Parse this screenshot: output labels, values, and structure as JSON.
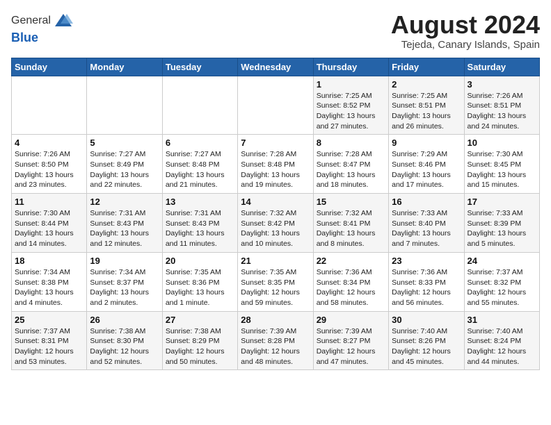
{
  "header": {
    "logo_line1": "General",
    "logo_line2": "Blue",
    "calendar_title": "August 2024",
    "calendar_subtitle": "Tejeda, Canary Islands, Spain"
  },
  "weekdays": [
    "Sunday",
    "Monday",
    "Tuesday",
    "Wednesday",
    "Thursday",
    "Friday",
    "Saturday"
  ],
  "weeks": [
    [
      {
        "day": "",
        "info": ""
      },
      {
        "day": "",
        "info": ""
      },
      {
        "day": "",
        "info": ""
      },
      {
        "day": "",
        "info": ""
      },
      {
        "day": "1",
        "info": "Sunrise: 7:25 AM\nSunset: 8:52 PM\nDaylight: 13 hours\nand 27 minutes."
      },
      {
        "day": "2",
        "info": "Sunrise: 7:25 AM\nSunset: 8:51 PM\nDaylight: 13 hours\nand 26 minutes."
      },
      {
        "day": "3",
        "info": "Sunrise: 7:26 AM\nSunset: 8:51 PM\nDaylight: 13 hours\nand 24 minutes."
      }
    ],
    [
      {
        "day": "4",
        "info": "Sunrise: 7:26 AM\nSunset: 8:50 PM\nDaylight: 13 hours\nand 23 minutes."
      },
      {
        "day": "5",
        "info": "Sunrise: 7:27 AM\nSunset: 8:49 PM\nDaylight: 13 hours\nand 22 minutes."
      },
      {
        "day": "6",
        "info": "Sunrise: 7:27 AM\nSunset: 8:48 PM\nDaylight: 13 hours\nand 21 minutes."
      },
      {
        "day": "7",
        "info": "Sunrise: 7:28 AM\nSunset: 8:48 PM\nDaylight: 13 hours\nand 19 minutes."
      },
      {
        "day": "8",
        "info": "Sunrise: 7:28 AM\nSunset: 8:47 PM\nDaylight: 13 hours\nand 18 minutes."
      },
      {
        "day": "9",
        "info": "Sunrise: 7:29 AM\nSunset: 8:46 PM\nDaylight: 13 hours\nand 17 minutes."
      },
      {
        "day": "10",
        "info": "Sunrise: 7:30 AM\nSunset: 8:45 PM\nDaylight: 13 hours\nand 15 minutes."
      }
    ],
    [
      {
        "day": "11",
        "info": "Sunrise: 7:30 AM\nSunset: 8:44 PM\nDaylight: 13 hours\nand 14 minutes."
      },
      {
        "day": "12",
        "info": "Sunrise: 7:31 AM\nSunset: 8:43 PM\nDaylight: 13 hours\nand 12 minutes."
      },
      {
        "day": "13",
        "info": "Sunrise: 7:31 AM\nSunset: 8:43 PM\nDaylight: 13 hours\nand 11 minutes."
      },
      {
        "day": "14",
        "info": "Sunrise: 7:32 AM\nSunset: 8:42 PM\nDaylight: 13 hours\nand 10 minutes."
      },
      {
        "day": "15",
        "info": "Sunrise: 7:32 AM\nSunset: 8:41 PM\nDaylight: 13 hours\nand 8 minutes."
      },
      {
        "day": "16",
        "info": "Sunrise: 7:33 AM\nSunset: 8:40 PM\nDaylight: 13 hours\nand 7 minutes."
      },
      {
        "day": "17",
        "info": "Sunrise: 7:33 AM\nSunset: 8:39 PM\nDaylight: 13 hours\nand 5 minutes."
      }
    ],
    [
      {
        "day": "18",
        "info": "Sunrise: 7:34 AM\nSunset: 8:38 PM\nDaylight: 13 hours\nand 4 minutes."
      },
      {
        "day": "19",
        "info": "Sunrise: 7:34 AM\nSunset: 8:37 PM\nDaylight: 13 hours\nand 2 minutes."
      },
      {
        "day": "20",
        "info": "Sunrise: 7:35 AM\nSunset: 8:36 PM\nDaylight: 13 hours\nand 1 minute."
      },
      {
        "day": "21",
        "info": "Sunrise: 7:35 AM\nSunset: 8:35 PM\nDaylight: 12 hours\nand 59 minutes."
      },
      {
        "day": "22",
        "info": "Sunrise: 7:36 AM\nSunset: 8:34 PM\nDaylight: 12 hours\nand 58 minutes."
      },
      {
        "day": "23",
        "info": "Sunrise: 7:36 AM\nSunset: 8:33 PM\nDaylight: 12 hours\nand 56 minutes."
      },
      {
        "day": "24",
        "info": "Sunrise: 7:37 AM\nSunset: 8:32 PM\nDaylight: 12 hours\nand 55 minutes."
      }
    ],
    [
      {
        "day": "25",
        "info": "Sunrise: 7:37 AM\nSunset: 8:31 PM\nDaylight: 12 hours\nand 53 minutes."
      },
      {
        "day": "26",
        "info": "Sunrise: 7:38 AM\nSunset: 8:30 PM\nDaylight: 12 hours\nand 52 minutes."
      },
      {
        "day": "27",
        "info": "Sunrise: 7:38 AM\nSunset: 8:29 PM\nDaylight: 12 hours\nand 50 minutes."
      },
      {
        "day": "28",
        "info": "Sunrise: 7:39 AM\nSunset: 8:28 PM\nDaylight: 12 hours\nand 48 minutes."
      },
      {
        "day": "29",
        "info": "Sunrise: 7:39 AM\nSunset: 8:27 PM\nDaylight: 12 hours\nand 47 minutes."
      },
      {
        "day": "30",
        "info": "Sunrise: 7:40 AM\nSunset: 8:26 PM\nDaylight: 12 hours\nand 45 minutes."
      },
      {
        "day": "31",
        "info": "Sunrise: 7:40 AM\nSunset: 8:24 PM\nDaylight: 12 hours\nand 44 minutes."
      }
    ]
  ]
}
